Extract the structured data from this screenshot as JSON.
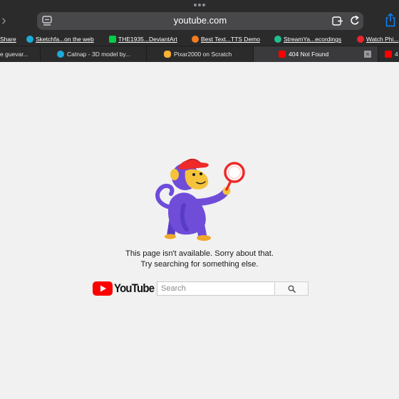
{
  "browser": {
    "url": "youtube.com",
    "bookmarks": [
      {
        "label": "Share",
        "icon": "none",
        "color": "#000000"
      },
      {
        "label": "Sketchfa...on the web",
        "icon": "sketchfab-icon",
        "color": "#1caad9"
      },
      {
        "label": "THE1935...DeviantArt",
        "icon": "deviantart-icon",
        "color": "#05cc47"
      },
      {
        "label": "Best Text...TTS Demo",
        "icon": "tts-icon",
        "color": "#f47b20"
      },
      {
        "label": "StreamYa...ecordings",
        "icon": "streamyard-icon",
        "color": "#1fbf8f"
      },
      {
        "label": "Watch Phi...",
        "icon": "disney-icon",
        "color": "#e9262d"
      }
    ],
    "tabs": [
      {
        "label": "e guevar...",
        "icon": "none",
        "active": false
      },
      {
        "label": "Catnap - 3D model by...",
        "icon": "sketchfab-icon",
        "active": false
      },
      {
        "label": "Pixar2000 on Scratch",
        "icon": "scratch-icon",
        "active": false
      },
      {
        "label": "404 Not Found",
        "icon": "youtube-icon",
        "active": true
      },
      {
        "label": "4",
        "icon": "youtube-icon",
        "active": false
      }
    ]
  },
  "page": {
    "message_line1": "This page isn't available. Sorry about that.",
    "message_line2": "Try searching for something else.",
    "logo_text": "YouTube",
    "search_placeholder": "Search",
    "search_value": ""
  },
  "colors": {
    "youtube_red": "#ff0000",
    "monkey_purple": "#6f4dd9",
    "monkey_face": "#f5c33b",
    "cap_red": "#ee2a2a",
    "page_bg": "#f1f1f1",
    "chrome_bg": "#2b2b2c"
  }
}
